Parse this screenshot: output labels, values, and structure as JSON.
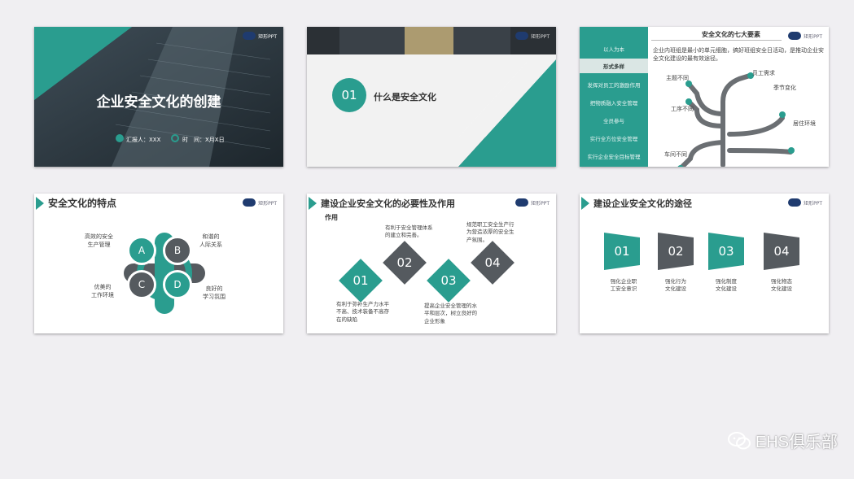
{
  "logo_text": "矩形PPT",
  "slide1": {
    "title": "企业安全文化的创建",
    "presenter": "汇报人：XXX",
    "time": "时　间：X月X日"
  },
  "slide2": {
    "number": "01",
    "title": "什么是安全文化"
  },
  "slide3": {
    "title": "安全文化的七大要素",
    "sidebar": [
      "以人为本",
      "形式多样",
      "发挥对员工的激励作用",
      "把物质融入安全管理",
      "全员参与",
      "实行全方位安全管理",
      "实行企业安全目标管理"
    ],
    "active_index": 1,
    "body": "企业内班组是最小的单元细胞，搞好班组安全日活动，是推动企业安全文化建设的最有效途径。",
    "labels": [
      "主题不同",
      "员工需求",
      "季节变化",
      "工序不同",
      "居住环境",
      "车间不同"
    ]
  },
  "slide4": {
    "title": "安全文化的特点",
    "letters": [
      "A",
      "B",
      "C",
      "D"
    ],
    "labels": {
      "a": "高效的安全\n生产管理",
      "b": "和谐的\n人际关系",
      "c": "优美的\n工作环境",
      "d": "良好的\n学习氛围"
    }
  },
  "slide5": {
    "title": "建设企业安全文化的必要性及作用",
    "subtitle": "作用",
    "numbers": [
      "01",
      "02",
      "03",
      "04"
    ],
    "texts": {
      "t01": "有利于弥补生产力水平不高、技术装备不高存在的缺陷",
      "t02": "有利于安全管理体系的建立和完善。",
      "t03": "提高企业安全管理的水平和层次，树立良好的企业形象",
      "t04": "规范职工安全生产行为营造浓厚的安全生产氛围。"
    }
  },
  "slide6": {
    "title": "建设企业安全文化的途径",
    "items": [
      {
        "num": "01",
        "label": "强化企业职\n工安全意识"
      },
      {
        "num": "02",
        "label": "强化行为\n文化建设"
      },
      {
        "num": "03",
        "label": "强化制度\n文化建设"
      },
      {
        "num": "04",
        "label": "强化物态\n文化建设"
      }
    ]
  },
  "watermark": "EHS俱乐部",
  "colors": {
    "teal": "#2a9d8f",
    "gray": "#555a5f",
    "bg": "#f0eff2"
  }
}
